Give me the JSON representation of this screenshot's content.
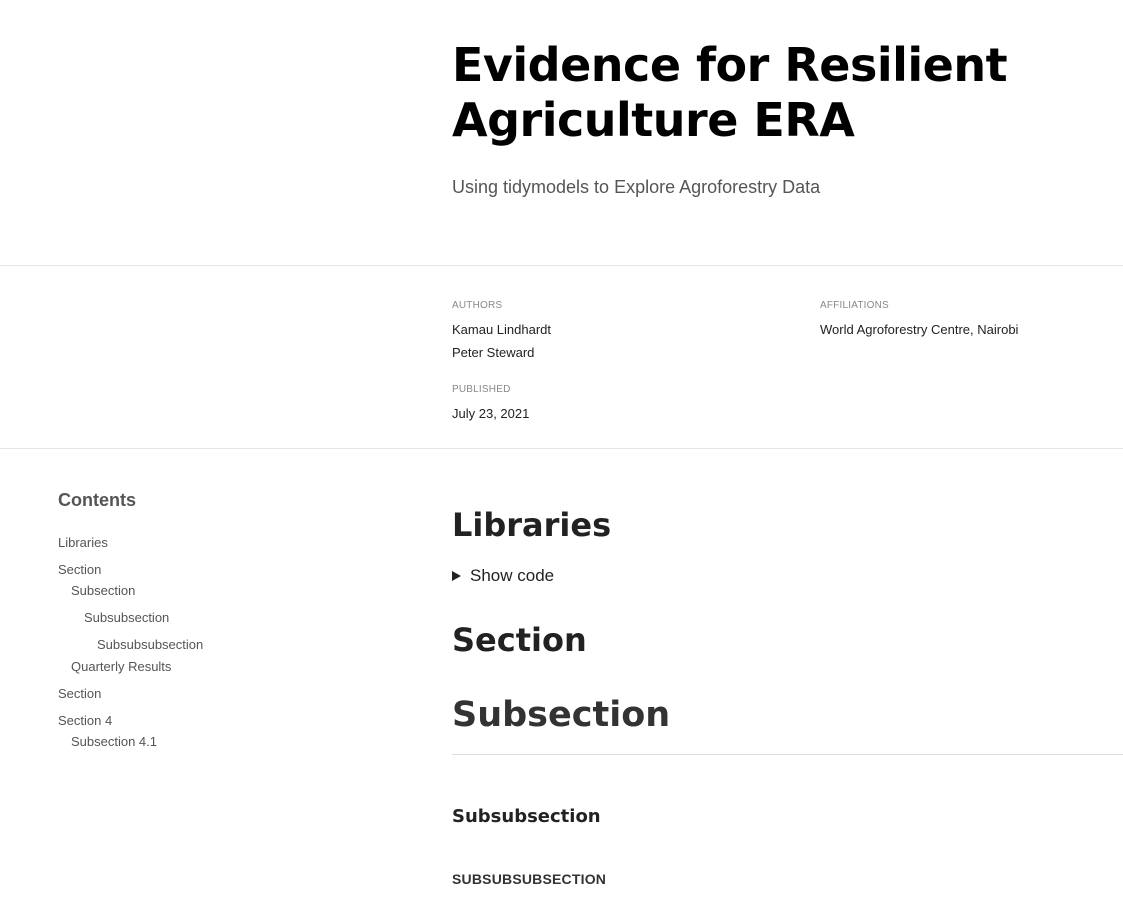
{
  "header": {
    "title": "Evidence for Resilient Agriculture ERA",
    "subtitle": "Using tidymodels to Explore Agroforestry Data"
  },
  "byline": {
    "authors_label": "AUTHORS",
    "authors": [
      "Kamau Lindhardt",
      "Peter Steward"
    ],
    "affiliations_label": "AFFILIATIONS",
    "affiliations": [
      "World Agroforestry Centre, Nairobi"
    ],
    "published_label": "PUBLISHED",
    "published": "July 23, 2021"
  },
  "toc": {
    "title": "Contents",
    "items": [
      {
        "label": "Libraries",
        "level": 1
      },
      {
        "label": "Section",
        "level": 1
      },
      {
        "label": "Subsection",
        "level": 2
      },
      {
        "label": "Subsubsection",
        "level": 3
      },
      {
        "label": "Subsubsubsection",
        "level": 4
      },
      {
        "label": "Quarterly Results",
        "level": 2
      },
      {
        "label": "Section",
        "level": 1
      },
      {
        "label": "Section 4",
        "level": 1
      },
      {
        "label": "Subsection 4.1",
        "level": 2
      }
    ]
  },
  "main": {
    "libraries_heading": "Libraries",
    "show_code_label": "Show code",
    "section_heading": "Section",
    "subsection_heading": "Subsection",
    "subsubsection_heading": "Subsubsection",
    "subsubsubsection_heading": "Subsubsubsection"
  }
}
